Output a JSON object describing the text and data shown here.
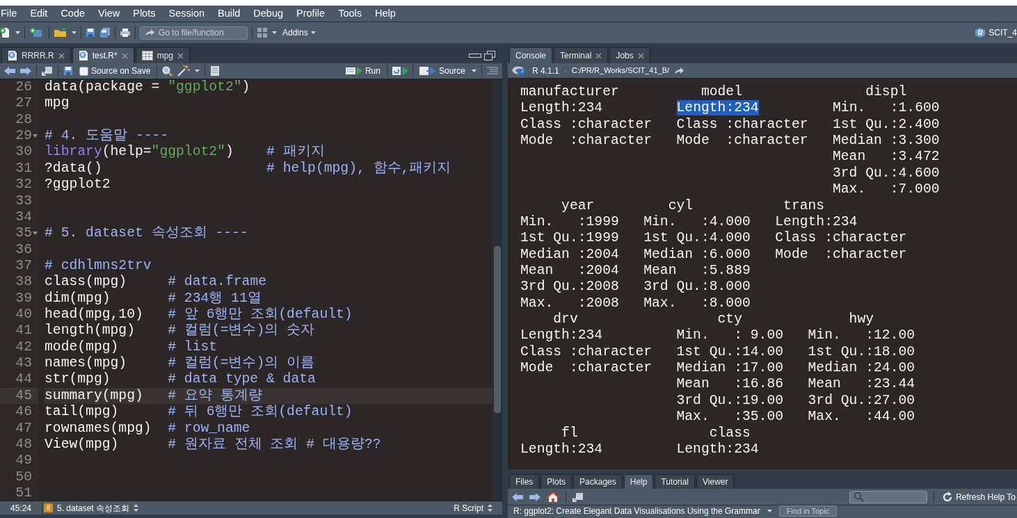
{
  "menu": [
    "File",
    "Edit",
    "Code",
    "View",
    "Plots",
    "Session",
    "Build",
    "Debug",
    "Profile",
    "Tools",
    "Help"
  ],
  "toolbar": {
    "goto_placeholder": "Go to file/function",
    "addins": "Addins",
    "project": "SCIT_4"
  },
  "editor": {
    "tabs": [
      {
        "label": "RRRR.R",
        "kind": "script",
        "selected": false
      },
      {
        "label": "test.R*",
        "kind": "script",
        "selected": true
      },
      {
        "label": "mpg",
        "kind": "table",
        "selected": false
      }
    ],
    "source_on_save": {
      "label": "Source on Save",
      "checked": false
    },
    "run": "Run",
    "source": "Source",
    "lines": [
      {
        "number": "26",
        "fold": false,
        "current": false,
        "segments": [
          {
            "text": "data(package = ",
            "kind": "code"
          },
          {
            "text": "\"ggplot2\"",
            "kind": "string"
          },
          {
            "text": ")",
            "kind": "code"
          }
        ]
      },
      {
        "number": "27",
        "fold": false,
        "current": false,
        "segments": [
          {
            "text": "mpg",
            "kind": "code"
          }
        ]
      },
      {
        "number": "28",
        "fold": false,
        "current": false
      },
      {
        "number": "29",
        "fold": true,
        "current": false,
        "segments": [
          {
            "text": "# 4. 도움말 ----",
            "kind": "comment"
          }
        ]
      },
      {
        "number": "30",
        "fold": false,
        "current": false,
        "segments": [
          {
            "text": "library",
            "kind": "function"
          },
          {
            "text": "(help=",
            "kind": "code"
          },
          {
            "text": "\"ggplot2\"",
            "kind": "string"
          },
          {
            "text": ")    ",
            "kind": "code"
          },
          {
            "text": "# 패키지",
            "kind": "comment"
          }
        ]
      },
      {
        "number": "31",
        "fold": false,
        "current": false,
        "segments": [
          {
            "text": "?data()                    ",
            "kind": "code"
          },
          {
            "text": "# help(mpg), 함수,패키지",
            "kind": "comment"
          }
        ]
      },
      {
        "number": "32",
        "fold": false,
        "current": false,
        "segments": [
          {
            "text": "?ggplot2",
            "kind": "code"
          }
        ]
      },
      {
        "number": "33",
        "fold": false,
        "current": false
      },
      {
        "number": "34",
        "fold": false,
        "current": false
      },
      {
        "number": "35",
        "fold": true,
        "current": false,
        "segments": [
          {
            "text": "# 5. dataset 속성조회 ----",
            "kind": "comment"
          }
        ]
      },
      {
        "number": "36",
        "fold": false,
        "current": false
      },
      {
        "number": "37",
        "fold": false,
        "current": false,
        "segments": [
          {
            "text": "# cdhlmns2trv",
            "kind": "comment"
          }
        ]
      },
      {
        "number": "38",
        "fold": false,
        "current": false,
        "segments": [
          {
            "text": "class(mpg)     ",
            "kind": "code"
          },
          {
            "text": "# data.frame",
            "kind": "comment"
          }
        ]
      },
      {
        "number": "39",
        "fold": false,
        "current": false,
        "segments": [
          {
            "text": "dim(mpg)       ",
            "kind": "code"
          },
          {
            "text": "# 234행 11열",
            "kind": "comment"
          }
        ]
      },
      {
        "number": "40",
        "fold": false,
        "current": false,
        "segments": [
          {
            "text": "head(mpg,10)   ",
            "kind": "code"
          },
          {
            "text": "# 앞 6행만 조회(default)",
            "kind": "comment"
          }
        ]
      },
      {
        "number": "41",
        "fold": false,
        "current": false,
        "segments": [
          {
            "text": "length(mpg)    ",
            "kind": "code"
          },
          {
            "text": "# 컬럼(=변수)의 숫자",
            "kind": "comment"
          }
        ]
      },
      {
        "number": "42",
        "fold": false,
        "current": false,
        "segments": [
          {
            "text": "mode(mpg)      ",
            "kind": "code"
          },
          {
            "text": "# list",
            "kind": "comment"
          }
        ]
      },
      {
        "number": "43",
        "fold": false,
        "current": false,
        "segments": [
          {
            "text": "names(mpg)     ",
            "kind": "code"
          },
          {
            "text": "# 컬럼(=변수)의 이름",
            "kind": "comment"
          }
        ]
      },
      {
        "number": "44",
        "fold": false,
        "current": false,
        "segments": [
          {
            "text": "str(mpg)       ",
            "kind": "code"
          },
          {
            "text": "# data type & data",
            "kind": "comment"
          }
        ]
      },
      {
        "number": "45",
        "fold": false,
        "current": true,
        "segments": [
          {
            "text": "summary(mpg)   ",
            "kind": "code"
          },
          {
            "text": "# 요약 통계량",
            "kind": "comment"
          }
        ]
      },
      {
        "number": "46",
        "fold": false,
        "current": false,
        "segments": [
          {
            "text": "tail(mpg)      ",
            "kind": "code"
          },
          {
            "text": "# 뒤 6행만 조회(default)",
            "kind": "comment"
          }
        ]
      },
      {
        "number": "47",
        "fold": false,
        "current": false,
        "segments": [
          {
            "text": "rownames(mpg)  ",
            "kind": "code"
          },
          {
            "text": "# row_name",
            "kind": "comment"
          }
        ]
      },
      {
        "number": "48",
        "fold": false,
        "current": false,
        "segments": [
          {
            "text": "View(mpg)      ",
            "kind": "code"
          },
          {
            "text": "# 원자료 전체 조회 # 대용량??",
            "kind": "comment"
          }
        ]
      },
      {
        "number": "49",
        "fold": false,
        "current": false
      },
      {
        "number": "50",
        "fold": false,
        "current": false
      },
      {
        "number": "51",
        "fold": false,
        "current": false
      }
    ],
    "status": {
      "position": "45:24",
      "section_badge": "#",
      "section": "5. dataset 속성조회",
      "file_type": "R Script"
    }
  },
  "console": {
    "tabs": [
      {
        "label": "Console",
        "closable": false,
        "selected": true
      },
      {
        "label": "Terminal",
        "closable": true,
        "selected": false
      },
      {
        "label": "Jobs",
        "closable": true,
        "selected": false
      }
    ],
    "version": "R 4.1.1",
    "separator": "·",
    "path": "C:/PR/R_Works/SCIT_41_B/",
    "lines": [
      {
        "segments": [
          {
            "text": "manufacturer          model               displ",
            "selected": false
          }
        ]
      },
      {
        "segments": [
          {
            "text": "Length:234         ",
            "selected": false
          },
          {
            "text": "Length:234",
            "selected": true
          },
          {
            "text": "         Min.   :1.600",
            "selected": false
          }
        ]
      },
      {
        "segments": [
          {
            "text": "Class :character   Class :character   1st Qu.:2.400",
            "selected": false
          }
        ]
      },
      {
        "segments": [
          {
            "text": "Mode  :character   Mode  :character   Median :3.300",
            "selected": false
          }
        ]
      },
      {
        "segments": [
          {
            "text": "                                      Mean   :3.472",
            "selected": false
          }
        ]
      },
      {
        "segments": [
          {
            "text": "                                      3rd Qu.:4.600",
            "selected": false
          }
        ]
      },
      {
        "segments": [
          {
            "text": "                                      Max.   :7.000",
            "selected": false
          }
        ]
      },
      {
        "segments": [
          {
            "text": "     year         cyl           trans",
            "selected": false
          }
        ]
      },
      {
        "segments": [
          {
            "text": "Min.   :1999   Min.   :4.000   Length:234",
            "selected": false
          }
        ]
      },
      {
        "segments": [
          {
            "text": "1st Qu.:1999   1st Qu.:4.000   Class :character",
            "selected": false
          }
        ]
      },
      {
        "segments": [
          {
            "text": "Median :2004   Median :6.000   Mode  :character",
            "selected": false
          }
        ]
      },
      {
        "segments": [
          {
            "text": "Mean   :2004   Mean   :5.889",
            "selected": false
          }
        ]
      },
      {
        "segments": [
          {
            "text": "3rd Qu.:2008   3rd Qu.:8.000",
            "selected": false
          }
        ]
      },
      {
        "segments": [
          {
            "text": "Max.   :2008   Max.   :8.000",
            "selected": false
          }
        ]
      },
      {
        "segments": [
          {
            "text": "    drv                 cty             hwy",
            "selected": false
          }
        ]
      },
      {
        "segments": [
          {
            "text": "Length:234         Min.   : 9.00   Min.   :12.00",
            "selected": false
          }
        ]
      },
      {
        "segments": [
          {
            "text": "Class :character   1st Qu.:14.00   1st Qu.:18.00",
            "selected": false
          }
        ]
      },
      {
        "segments": [
          {
            "text": "Mode  :character   Median :17.00   Median :24.00",
            "selected": false
          }
        ]
      },
      {
        "segments": [
          {
            "text": "                   Mean   :16.86   Mean   :23.44",
            "selected": false
          }
        ]
      },
      {
        "segments": [
          {
            "text": "                   3rd Qu.:19.00   3rd Qu.:27.00",
            "selected": false
          }
        ]
      },
      {
        "segments": [
          {
            "text": "                   Max.   :35.00   Max.   :44.00",
            "selected": false
          }
        ]
      },
      {
        "segments": [
          {
            "text": "     fl                class",
            "selected": false
          }
        ]
      },
      {
        "segments": [
          {
            "text": "Length:234         Length:234",
            "selected": false
          }
        ]
      }
    ]
  },
  "help": {
    "tabs": [
      {
        "label": "Files",
        "selected": false
      },
      {
        "label": "Plots",
        "selected": false
      },
      {
        "label": "Packages",
        "selected": false
      },
      {
        "label": "Help",
        "selected": true
      },
      {
        "label": "Tutorial",
        "selected": false
      },
      {
        "label": "Viewer",
        "selected": false
      }
    ],
    "refresh": "Refresh Help To",
    "topic": "R: ggplot2: Create Elegant Data Visualisations Using the Grammar",
    "find": "Find in Topic"
  }
}
